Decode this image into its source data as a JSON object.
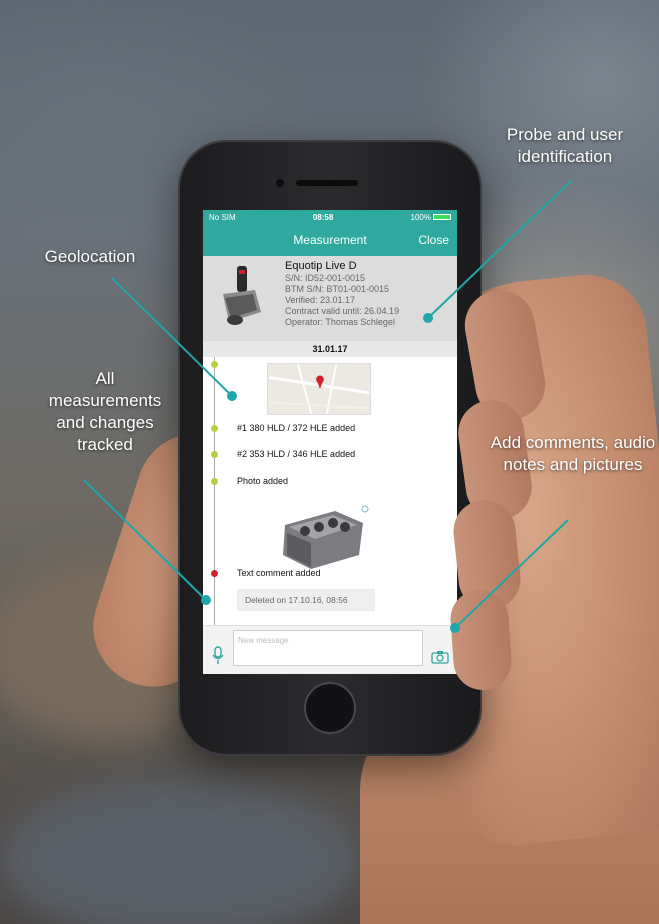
{
  "callouts": {
    "probe": "Probe and user identification",
    "geolocation": "Geolocation",
    "tracked": "All measurements and changes tracked",
    "comments": "Add comments, audio notes and pictures"
  },
  "status_bar": {
    "carrier": "No SIM",
    "time": "08:58",
    "battery": "100%"
  },
  "nav": {
    "title": "Measurement",
    "close_label": "Close"
  },
  "device": {
    "name": "Equotip Live D",
    "serial": "S/N: ID52-001-0015",
    "btm_serial": "BTM S/N: BT01-001-0015",
    "verified": "Verified: 23.01.17",
    "contract": "Contract valid until: 26.04.19",
    "operator": "Operator: Thomas Schlegel"
  },
  "timeline": {
    "date": "31.01.17",
    "entries": [
      {
        "text": "#1 380 HLD / 372 HLE added"
      },
      {
        "text": "#2 353 HLD / 346 HLE added"
      },
      {
        "text": "Photo added"
      },
      {
        "text": "Text comment added"
      }
    ],
    "deleted_note": "Deleted on 17.10.16, 08:56"
  },
  "composer": {
    "placeholder": "New message"
  },
  "colors": {
    "accent": "#2fa89d",
    "dot_green": "#b5cf3f",
    "dot_red": "#d0232a"
  }
}
